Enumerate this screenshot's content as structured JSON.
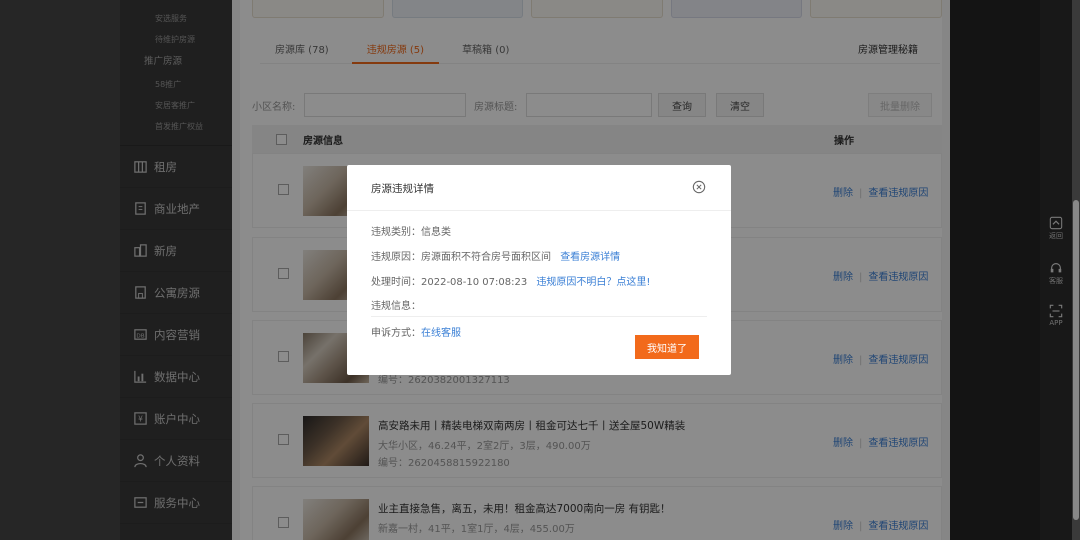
{
  "sidebar": {
    "sub_top": [
      "安选服务",
      "待维护房源"
    ],
    "group_label": "推广房源",
    "sub_promo": [
      "58推广",
      "安居客推广",
      "首发推广权益"
    ],
    "items": [
      {
        "icon": "house-icon",
        "label": "租房"
      },
      {
        "icon": "building-icon",
        "label": "商业地产"
      },
      {
        "icon": "new-home-icon",
        "label": "新房"
      },
      {
        "icon": "apartment-icon",
        "label": "公寓房源"
      },
      {
        "icon": "content-marketing-icon",
        "label": "内容营销"
      },
      {
        "icon": "data-chart-icon",
        "label": "数据中心"
      },
      {
        "icon": "account-icon",
        "label": "账户中心"
      },
      {
        "icon": "user-icon",
        "label": "个人资料"
      },
      {
        "icon": "service-icon",
        "label": "服务中心"
      }
    ]
  },
  "tabs": {
    "items": [
      "房源库 (78)",
      "违规房源 (5)",
      "草稿箱 (0)"
    ],
    "active_index": 1,
    "secrets_label": "房源管理秘籍"
  },
  "filter": {
    "community_label": "小区名称:",
    "title_label": "房源标题:",
    "search_label": "查询",
    "clear_label": "清空",
    "batch_delete_label": "批量删除"
  },
  "table": {
    "header_info": "房源信息",
    "header_ops": "操作",
    "delete_label": "删除",
    "reason_label": "查看违规原因",
    "rows": [
      {
        "title": "",
        "meta": "",
        "code": ""
      },
      {
        "title": "",
        "meta": "",
        "code": ""
      },
      {
        "title": "",
        "meta": "",
        "code": "编号：2620382001327113"
      },
      {
        "title": "高安路未用丨精装电梯双南两房丨租金可达七千丨送全屋50W精装",
        "meta": "大华小区，46.24平，2室2厅，3层，490.00万",
        "code": "编号：2620458815922180"
      },
      {
        "title": "业主直接急售，离五，未用！租金高达7000南向一房 有钥匙！",
        "meta": "新嘉一村，41平，1室1厅，4层，455.00万",
        "code": ""
      }
    ]
  },
  "right_tools": [
    {
      "icon": "scroll-top-icon",
      "label": "返回"
    },
    {
      "icon": "headset-icon",
      "label": "客服"
    },
    {
      "icon": "qr-scan-icon",
      "label": "APP"
    }
  ],
  "modal": {
    "title": "房源违规详情",
    "type_label": "违规类别：",
    "type_value": "信息类",
    "reason_label": "违规原因：",
    "reason_value": "房源面积不符合房号面积区间",
    "reason_link": "查看房源详情",
    "time_label": "处理时间：",
    "time_value": "2022-08-10 07:08:23",
    "time_link": "违规原因不明白？点这里!",
    "info_label": "违规信息：",
    "appeal_label": "申诉方式：",
    "appeal_link": "在线客服",
    "confirm_label": "我知道了"
  },
  "colors": {
    "accent": "#f26a1b",
    "link": "#3a7fd5",
    "sidebar_bg": "#3a3a3a"
  }
}
